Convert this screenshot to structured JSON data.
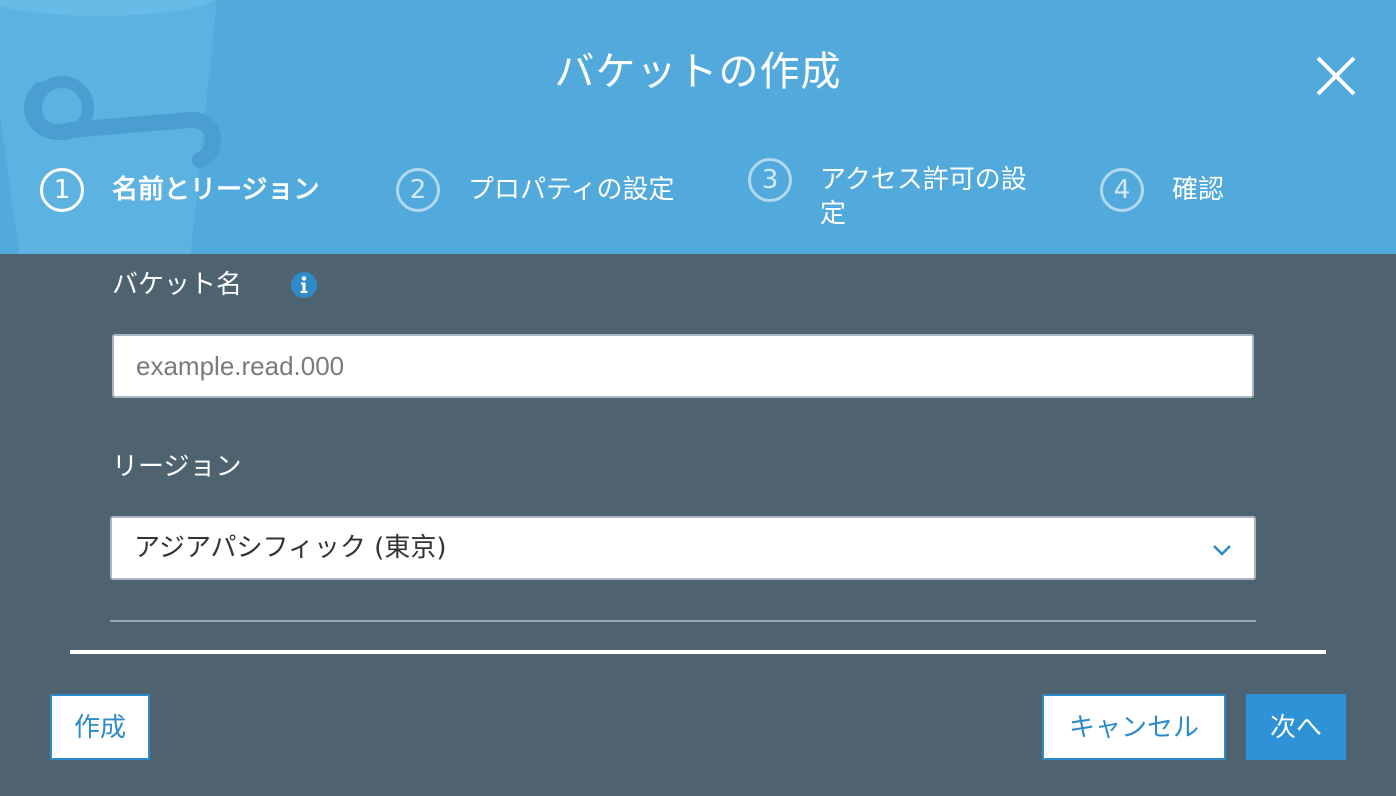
{
  "dialog": {
    "title": "バケットの作成",
    "close_icon": "close-icon"
  },
  "steps": [
    {
      "number": "1",
      "label": "名前とリージョン",
      "active": true
    },
    {
      "number": "2",
      "label": "プロパティの設定",
      "active": false
    },
    {
      "number": "3",
      "label": "アクセス許可の設定",
      "active": false
    },
    {
      "number": "4",
      "label": "確認",
      "active": false
    }
  ],
  "form": {
    "bucket_name": {
      "label": "バケット名",
      "info_icon": "info-icon",
      "value": "",
      "placeholder": "example.read.000"
    },
    "region": {
      "label": "リージョン",
      "selected": "アジアパシフィック (東京)",
      "dropdown_icon": "chevron-down-icon"
    }
  },
  "footer": {
    "create_label": "作成",
    "cancel_label": "キャンセル",
    "next_label": "次へ"
  },
  "colors": {
    "header_bg": "#52a9db",
    "body_bg": "#4e6270",
    "accent": "#2d8bc9",
    "primary_button": "#2f91d6"
  }
}
